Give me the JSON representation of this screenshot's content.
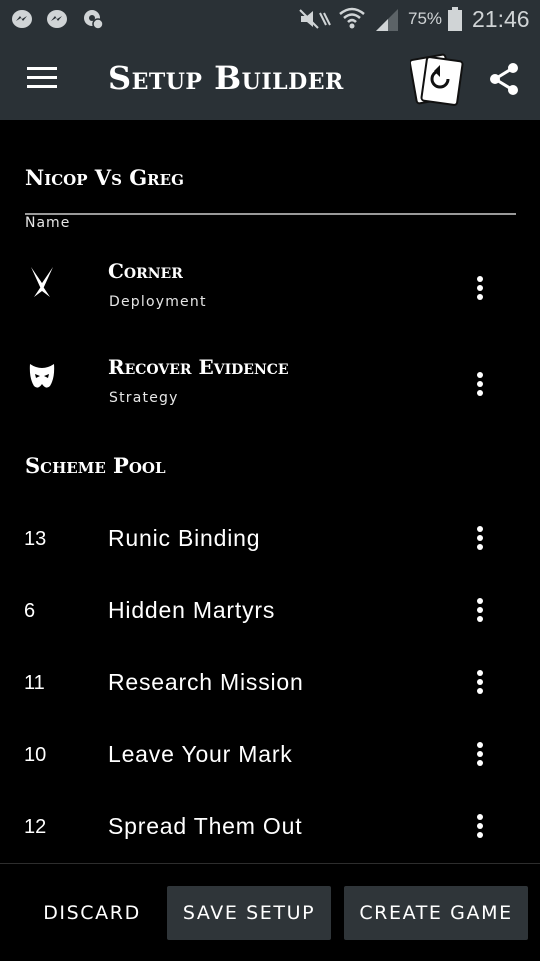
{
  "status_bar": {
    "battery_percent": "75%",
    "time": "21:46",
    "icons": [
      "messenger-icon",
      "messenger-icon",
      "location-icon",
      "mute-icon",
      "wifi-icon",
      "signal-icon",
      "battery-icon"
    ]
  },
  "app_bar": {
    "title": "Setup Builder",
    "menu_icon": "hamburger-icon",
    "actions": [
      "reset-cards-icon",
      "share-icon"
    ]
  },
  "setup": {
    "title": "Nicop Vs Greg",
    "name_label": "Name",
    "items": [
      {
        "title": "Corner",
        "subtitle": "Deployment",
        "icon": "crossed-swords-icon"
      },
      {
        "title": "Recover Evidence",
        "subtitle": "Strategy",
        "icon": "mask-icon"
      }
    ]
  },
  "scheme_pool": {
    "title": "Scheme Pool",
    "items": [
      {
        "number": "13",
        "name": "Runic Binding"
      },
      {
        "number": "6",
        "name": "Hidden Martyrs"
      },
      {
        "number": "11",
        "name": "Research Mission"
      },
      {
        "number": "10",
        "name": "Leave Your Mark"
      },
      {
        "number": "12",
        "name": "Spread Them Out"
      }
    ]
  },
  "actions": {
    "discard": "DISCARD",
    "save_setup": "SAVE SETUP",
    "create_game": "CREATE GAME"
  },
  "colors": {
    "app_bar": "#2a3136",
    "background": "#000000",
    "button": "#2f3539",
    "text": "#ffffff"
  }
}
